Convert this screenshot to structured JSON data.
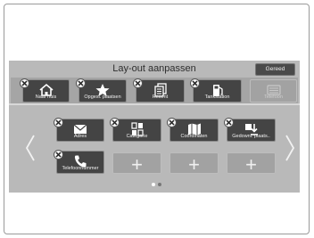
{
  "screen": {
    "title": "Lay-out aanpassen",
    "done_label": "Gereed"
  },
  "favorites": [
    {
      "label": "Naar huis",
      "icon": "home-icon"
    },
    {
      "label": "Opgesl. plaatsen",
      "icon": "star-icon"
    },
    {
      "label": "Recent",
      "icon": "recent-list-icon"
    },
    {
      "label": "Tankstation",
      "icon": "fuel-pump-icon"
    },
    {
      "label": "Telefoon",
      "icon": "keypad-icon",
      "state": "disabled"
    }
  ],
  "grid": [
    {
      "label": "Adres",
      "icon": "envelope-icon"
    },
    {
      "label": "Categorie",
      "icon": "category-grid-icon"
    },
    {
      "label": "Coördinaten",
      "icon": "map-icon"
    },
    {
      "label": "Gedownl. plaats..",
      "icon": "download-place-icon"
    },
    {
      "label": "Telefoonnummer",
      "icon": "phone-icon"
    }
  ],
  "empty_slot_symbol": "+",
  "pagination": {
    "page": 1,
    "pages": 2
  },
  "colors": {
    "background": "#b9b9b9",
    "tile": "#444444",
    "active_dot": "#ffffff",
    "inactive_dot": "#777777"
  }
}
